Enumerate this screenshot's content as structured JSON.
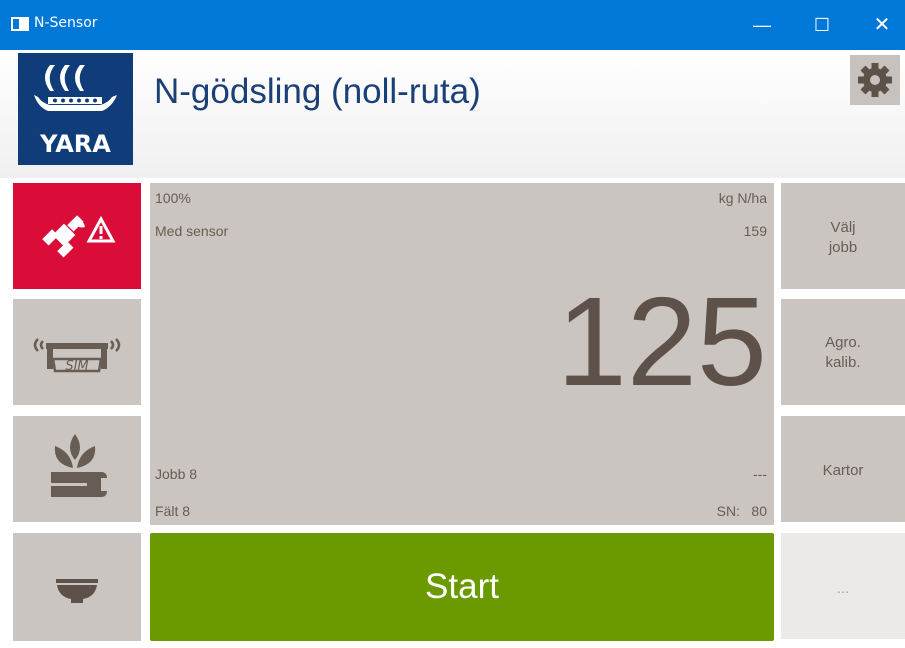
{
  "window": {
    "title": "N-Sensor",
    "minimize_glyph": "—",
    "maximize_glyph": "☐",
    "close_glyph": "✕",
    "accent_color": "#0078d7"
  },
  "header": {
    "logo_text": "YARA",
    "page_title": "N-gödsling (noll-ruta)",
    "settings_icon": "gear-icon"
  },
  "left_buttons": [
    {
      "name": "gps-warning-button",
      "icon": "satellite-warning-icon",
      "color": "#d90d37"
    },
    {
      "name": "sensor-simulation-button",
      "icon": "sensor-sim-icon"
    },
    {
      "name": "crop-settings-button",
      "icon": "plant-wrench-icon"
    },
    {
      "name": "spreader-button",
      "icon": "bowl-icon"
    }
  ],
  "main": {
    "rate_percent": "100%",
    "unit": "kg N/ha",
    "mode_label": "Med sensor",
    "sensor_value": "159",
    "big_value": "125",
    "job_label": "Jobb 8",
    "job_value": "---",
    "field_label": "Fält 8",
    "sn_label": "SN:",
    "sn_value": "80"
  },
  "start_button": {
    "label": "Start",
    "color": "#6b9a00"
  },
  "right_buttons": {
    "select_job": "Välj\njobb",
    "agro_calib": "Agro.\nkalib.",
    "maps": "Kartor",
    "more": "..."
  }
}
